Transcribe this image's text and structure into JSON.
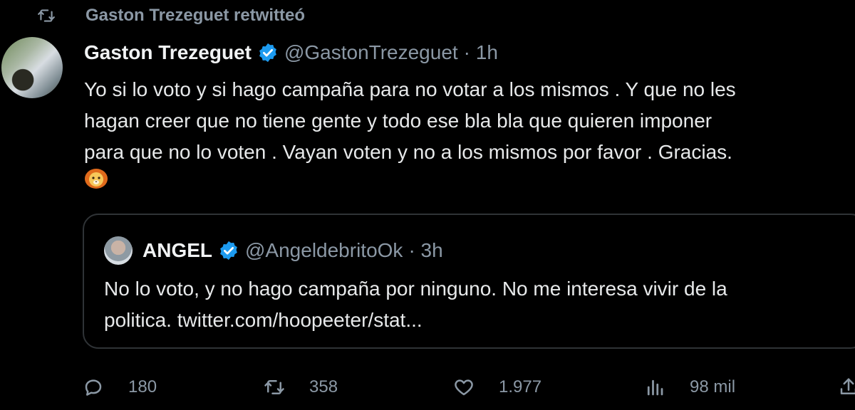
{
  "retweet": {
    "text": "Gaston Trezeguet retwitteó"
  },
  "tweet": {
    "name": "Gaston Trezeguet",
    "handle": "@GastonTrezeguet",
    "time": "· 1h",
    "lines": [
      "Yo si lo voto y si hago campaña para no votar a los mismos . Y que no les",
      "hagan creer que no tiene gente y todo ese bla bla que quieren imponer",
      "para que no lo voten .  Vayan voten y no a los mismos por favor . Gracias."
    ],
    "emoji_icon": "lion-face-icon"
  },
  "quote": {
    "name": "ANGEL",
    "handle": "@AngeldebritoOk",
    "time": "· 3h",
    "lines": [
      "No lo voto, y no hago campaña por ninguno. No me interesa vivir de la",
      "politica. twitter.com/hoopeeter/stat..."
    ]
  },
  "actions": {
    "replies": "180",
    "retweets": "358",
    "likes": "1.977",
    "views": "98 mil"
  },
  "colors": {
    "background": "#000000",
    "text": "#e7e9ea",
    "muted": "#8b98a5",
    "verified": "#1d9bf0",
    "border": "#2f3336"
  }
}
